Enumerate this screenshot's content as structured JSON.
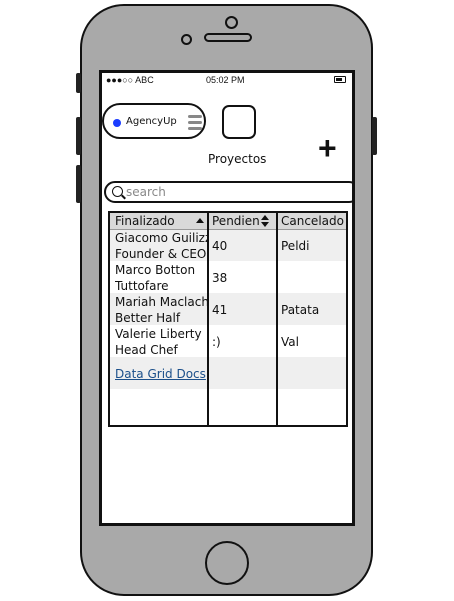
{
  "status_bar": {
    "carrier": "●●●○○ ABC",
    "time": "05:02 PM"
  },
  "header": {
    "brand_label": "AgencyUp",
    "projects_label": "Proyectos"
  },
  "search": {
    "placeholder": "search"
  },
  "grid": {
    "headers": [
      "Finalizado",
      "Pendien",
      "Cancelado"
    ],
    "rows": [
      {
        "name": "Giacomo Guilizzoni",
        "subtitle": "Founder & CEO",
        "pending": "40",
        "cancelled": "Peldi"
      },
      {
        "name": "Marco Botton",
        "subtitle": "Tuttofare",
        "pending": "38",
        "cancelled": ""
      },
      {
        "name": "Mariah Maclachlan",
        "subtitle": "Better Half",
        "pending": "41",
        "cancelled": "Patata"
      },
      {
        "name": "Valerie Liberty",
        "subtitle": "Head Chef",
        "pending": ":)",
        "cancelled": "Val"
      }
    ],
    "link_label": "Data Grid Docs"
  },
  "colors": {
    "phone_body": "#a9a9a9",
    "status_dot": "#1a3cff",
    "link": "#1b4f8a",
    "header_bg": "#d9d9d9",
    "alt_row_bg": "#efefef"
  }
}
